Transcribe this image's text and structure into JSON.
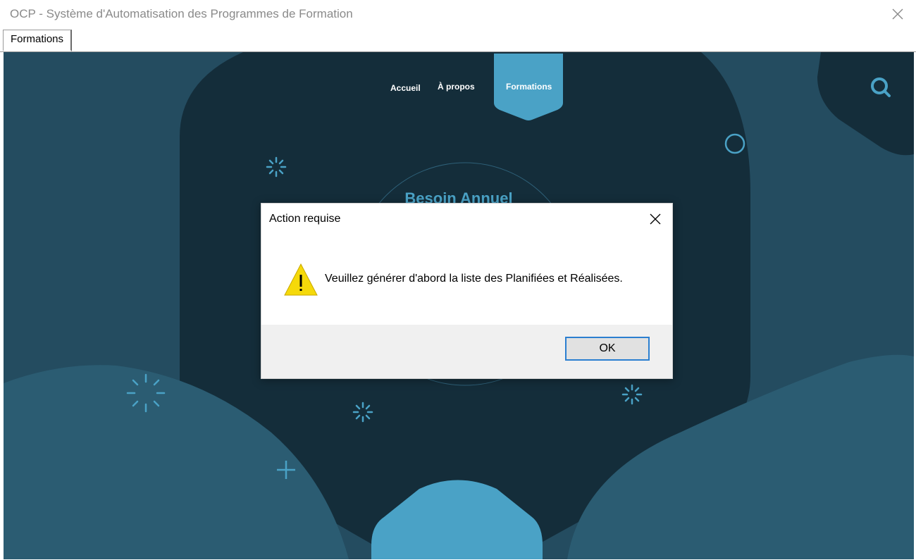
{
  "window": {
    "title": "OCP - Système d'Automatisation des Programmes de Formation"
  },
  "tabs": [
    {
      "label": "Formations",
      "selected": true
    }
  ],
  "site": {
    "nav": [
      {
        "label": "Accueil",
        "active": false
      },
      {
        "label": "À propos",
        "active": false
      },
      {
        "label": "Formations",
        "active": true
      }
    ],
    "heading": "Besoin Annuel",
    "icons": [
      "search-icon",
      "circle-ring-icon",
      "sparkle-icon",
      "plus-icon"
    ]
  },
  "dialog": {
    "title": "Action requise",
    "message": "Veuillez générer d'abord la liste des Planifiées et Réalisées.",
    "icon": "warning-icon",
    "ok_label": "OK"
  },
  "colors": {
    "background_dark": "#142d3a",
    "background_mid": "#244c60",
    "background_light": "#2b5c72",
    "accent": "#4aa2c6",
    "dialog_button_border": "#2b7fd0"
  }
}
